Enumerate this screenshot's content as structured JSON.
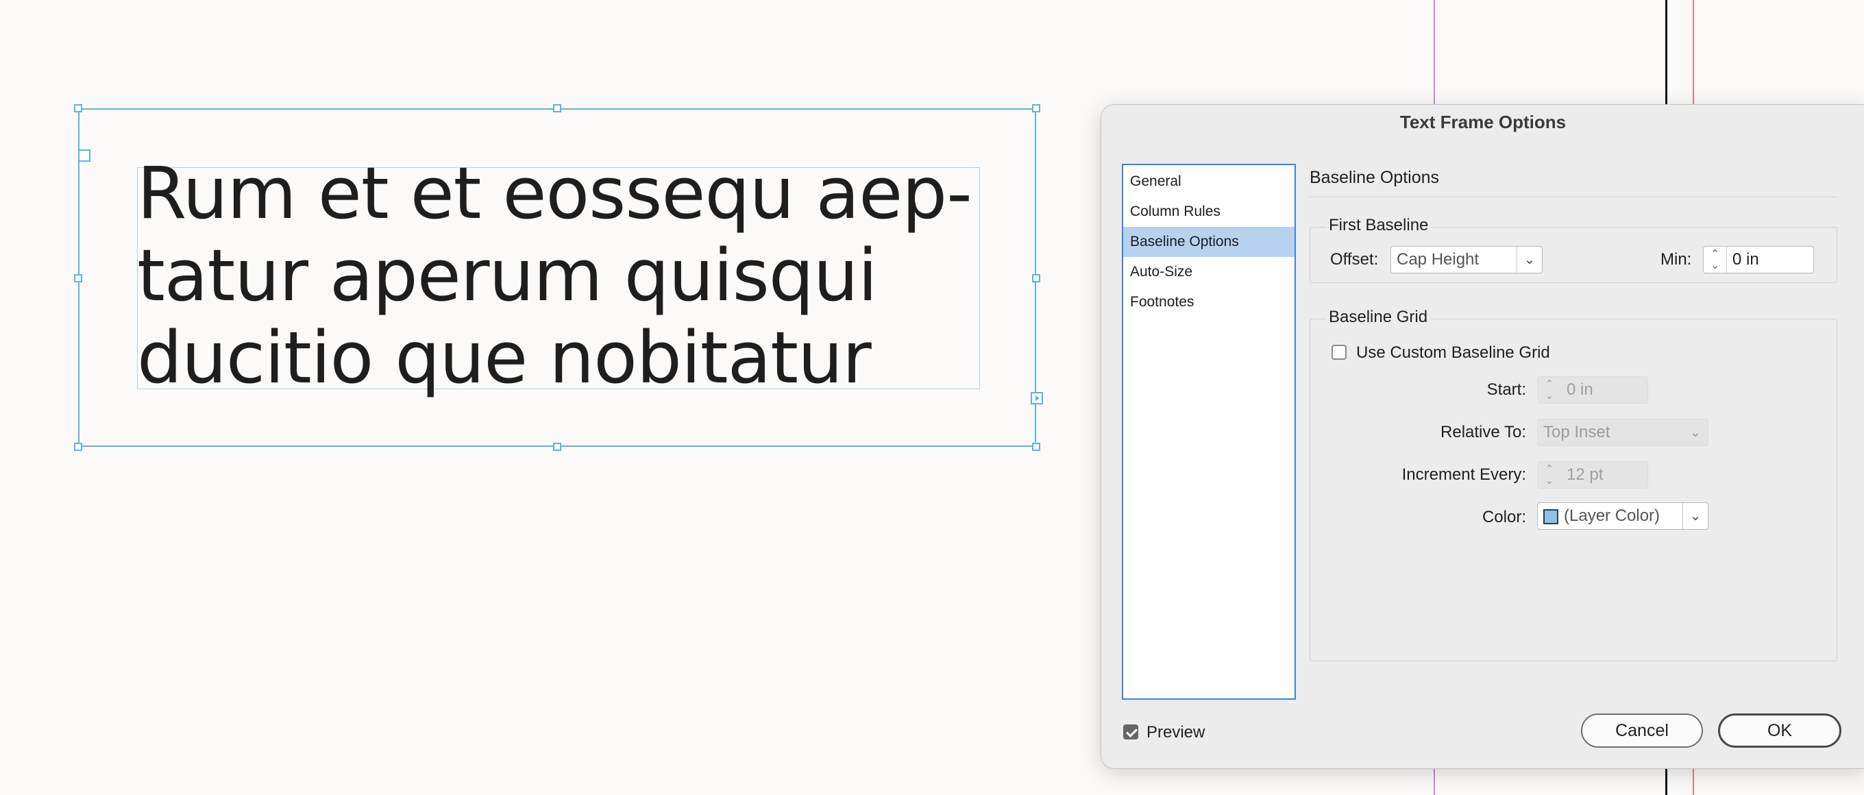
{
  "canvas": {
    "frame_text_lines": [
      "Rum et et eossequ aep-",
      "tatur aperum quisqui",
      "ducitio que nobitatur"
    ]
  },
  "dialog": {
    "title": "Text Frame Options",
    "nav": [
      {
        "label": "General",
        "selected": false
      },
      {
        "label": "Column Rules",
        "selected": false
      },
      {
        "label": "Baseline Options",
        "selected": true
      },
      {
        "label": "Auto-Size",
        "selected": false
      },
      {
        "label": "Footnotes",
        "selected": false
      }
    ],
    "section_title": "Baseline Options",
    "first_baseline": {
      "legend": "First Baseline",
      "offset_label": "Offset:",
      "offset_value": "Cap Height",
      "min_label": "Min:",
      "min_value": "0 in"
    },
    "baseline_grid": {
      "legend": "Baseline Grid",
      "use_custom_label": "Use Custom Baseline Grid",
      "use_custom_checked": false,
      "start_label": "Start:",
      "start_value": "0 in",
      "relative_to_label": "Relative To:",
      "relative_to_value": "Top Inset",
      "increment_label": "Increment Every:",
      "increment_value": "12 pt",
      "color_label": "Color:",
      "color_value": "(Layer Color)",
      "color_swatch": "#8ec2ea"
    },
    "preview_label": "Preview",
    "preview_checked": true,
    "cancel_label": "Cancel",
    "ok_label": "OK"
  },
  "colors": {
    "frame_selection": "#5fb3d9",
    "nav_selected": "#b6d2ef",
    "nav_border": "#3b85d1"
  }
}
